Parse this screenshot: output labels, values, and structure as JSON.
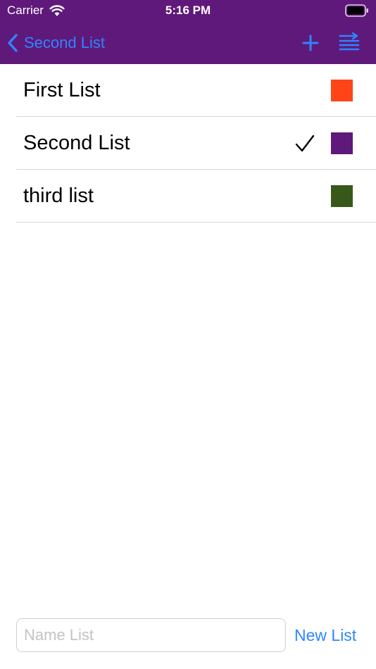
{
  "status_bar": {
    "carrier": "Carrier",
    "time": "5:16 PM",
    "wifi_icon": "wifi-icon",
    "battery_icon": "battery-icon"
  },
  "nav_bar": {
    "back_label": "Second List",
    "back_icon": "chevron-left-icon",
    "add_icon": "plus-icon",
    "reorder_icon": "list-reorder-icon",
    "background_color": "#5f197a",
    "tint_color": "#2e86ff"
  },
  "lists": [
    {
      "name": "First List",
      "color": "#ff4417",
      "selected": false
    },
    {
      "name": "Second List",
      "color": "#5f197a",
      "selected": true
    },
    {
      "name": "third list",
      "color": "#37581a",
      "selected": false
    }
  ],
  "footer": {
    "name_placeholder": "Name List",
    "name_value": "",
    "new_list_label": "New List"
  }
}
